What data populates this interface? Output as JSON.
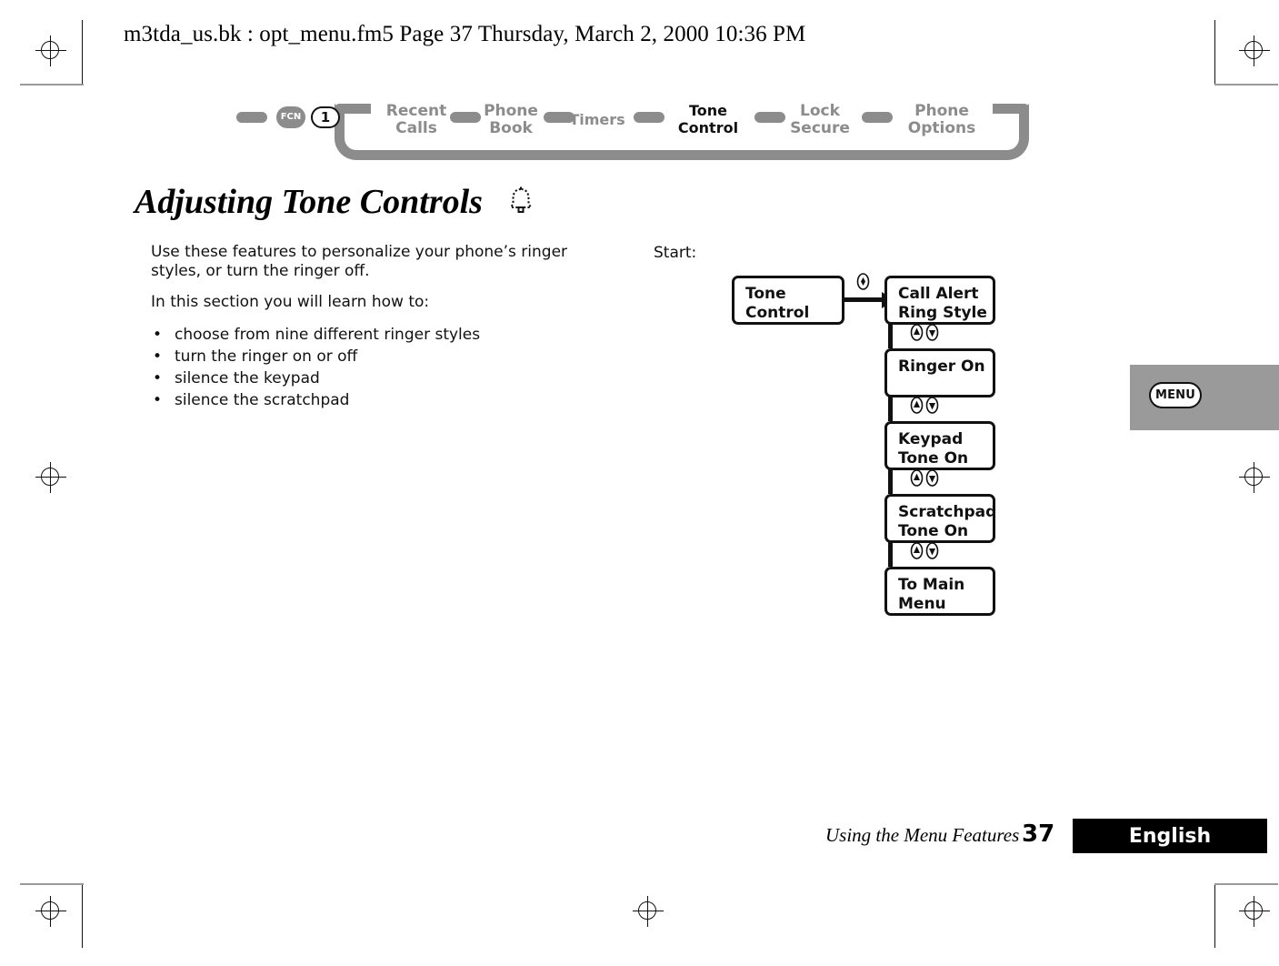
{
  "header": {
    "filename_line": "m3tda_us.bk : opt_menu.fm5  Page 37  Thursday, March 2, 2000  10:36 PM"
  },
  "breadcrumb": {
    "keys": [
      {
        "label": "FCN",
        "style": "filled"
      },
      {
        "label": "1",
        "style": "outline"
      }
    ],
    "items": [
      {
        "label": "Recent\nCalls",
        "active": false
      },
      {
        "label": "Phone\nBook",
        "active": false
      },
      {
        "label": "Timers",
        "active": false
      },
      {
        "label": "Tone\nControl",
        "active": true
      },
      {
        "label": "Lock\nSecure",
        "active": false
      },
      {
        "label": "Phone\nOptions",
        "active": false
      }
    ]
  },
  "title": {
    "text": "Adjusting Tone Controls",
    "icon": "bell-icon"
  },
  "content": {
    "intro": "Use these features to personalize your phone’s ringer styles, or turn the ringer off.",
    "lead_in": "In this section you will learn how to:",
    "bullet_char": "•",
    "bullets": [
      "choose from nine different ringer styles",
      "turn the ringer on or off",
      "silence the keypad",
      "silence the scratchpad"
    ]
  },
  "flowchart": {
    "start_label": "Start:",
    "start_box": "Tone\nControl",
    "steps": [
      "Call Alert\nRing Style",
      "Ringer On",
      "Keypad\nTone On",
      "Scratchpad\nTone On",
      "To Main\nMenu"
    ],
    "key_icons": {
      "select": "select-key-icon",
      "up": "up-key-icon",
      "down": "down-key-icon"
    }
  },
  "menu_tab": {
    "button_label": "MENU"
  },
  "footer": {
    "section": "Using the Menu Features",
    "page_number": "37",
    "language": "English"
  },
  "colors": {
    "nav_gray": "#8c8c8c",
    "tab_gray": "#9a9a9a",
    "ink": "#111111",
    "footer_bar": "#000000"
  }
}
